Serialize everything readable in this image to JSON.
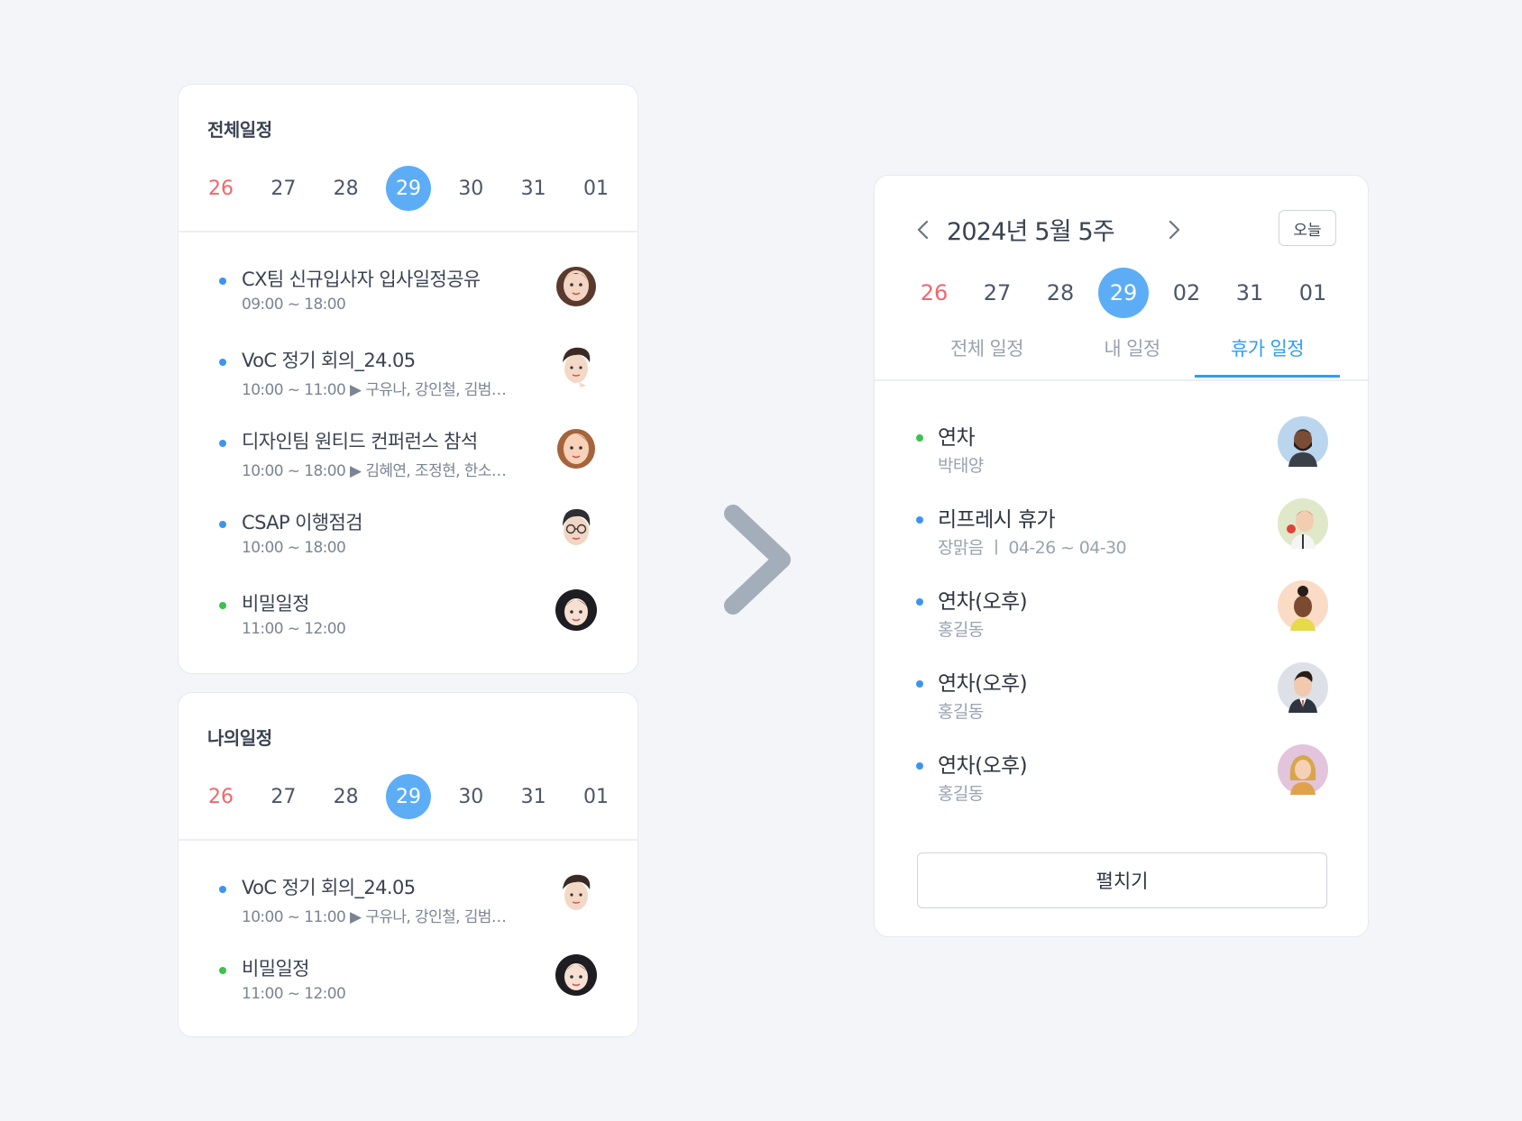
{
  "colors": {
    "accent": "#2e9df4",
    "selected_date": "#5cadf6",
    "sunday": "#f0676b",
    "dot_blue": "#3d94f0",
    "dot_green": "#3dc24a"
  },
  "all_schedule": {
    "title": "전체일정",
    "dates": [
      "26",
      "27",
      "28",
      "29",
      "30",
      "31",
      "01"
    ],
    "events": [
      {
        "title": "CX팀 신규입사자 입사일정공유",
        "sub": "09:00 ~ 18:00",
        "dot": "blue",
        "avatar": "woman-memoji-icon"
      },
      {
        "title": "VoC 정기 회의_24.05",
        "sub": "10:00 ~ 11:00 ▶ 구유나, 강인철, 김범…",
        "dot": "blue",
        "avatar": "man-memoji-icon"
      },
      {
        "title": "디자인팀 원티드 컨퍼런스 참석",
        "sub": "10:00 ~ 18:00 ▶ 김혜연, 조정현, 한소…",
        "dot": "blue",
        "avatar": "woman-memoji-icon"
      },
      {
        "title": "CSAP 이행점검",
        "sub": "10:00 ~ 18:00",
        "dot": "blue",
        "avatar": "man-glasses-memoji-icon"
      },
      {
        "title": "비밀일정",
        "sub": "11:00 ~ 12:00",
        "dot": "green",
        "avatar": "woman-memoji-icon"
      }
    ]
  },
  "my_schedule": {
    "title": "나의일정",
    "dates": [
      "26",
      "27",
      "28",
      "29",
      "30",
      "31",
      "01"
    ],
    "events": [
      {
        "title": "VoC 정기 회의_24.05",
        "sub": "10:00 ~ 11:00 ▶ 구유나, 강인철, 김범…",
        "dot": "blue",
        "avatar": "man-memoji-icon"
      },
      {
        "title": "비밀일정",
        "sub": "11:00 ~ 12:00",
        "dot": "green",
        "avatar": "woman-memoji-icon"
      }
    ]
  },
  "weekly": {
    "week_label": "2024년 5월 5주",
    "today_label": "오늘",
    "dates": [
      "26",
      "27",
      "28",
      "29",
      "02",
      "31",
      "01"
    ],
    "tabs": [
      "전체 일정",
      "내 일정",
      "휴가 일정"
    ],
    "active_tab": "휴가 일정",
    "events": [
      {
        "title": "연차",
        "sub": "박태양",
        "dot": "green",
        "avatar": "man-beard-avatar-icon"
      },
      {
        "title": "리프레시 휴가",
        "sub": "장맑음 ㅣ 04-26 ~ 04-30",
        "dot": "blue",
        "avatar": "man-apple-avatar-icon"
      },
      {
        "title": "연차(오후)",
        "sub": "홍길동",
        "dot": "blue",
        "avatar": "woman-bun-avatar-icon"
      },
      {
        "title": "연차(오후)",
        "sub": "홍길동",
        "dot": "blue",
        "avatar": "man-suit-avatar-icon"
      },
      {
        "title": "연차(오후)",
        "sub": "홍길동",
        "dot": "blue",
        "avatar": "woman-blonde-avatar-icon"
      }
    ],
    "expand_label": "펼치기"
  }
}
